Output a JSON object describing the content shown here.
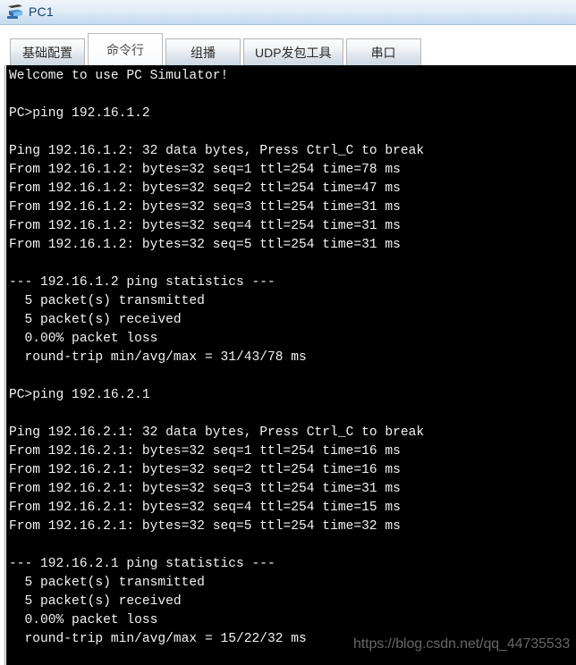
{
  "window": {
    "title": "PC1",
    "icon": "pc-device-icon"
  },
  "tabs": [
    {
      "label": "基础配置",
      "active": false
    },
    {
      "label": "命令行",
      "active": true
    },
    {
      "label": "组播",
      "active": false
    },
    {
      "label": "UDP发包工具",
      "active": false
    },
    {
      "label": "串口",
      "active": false
    }
  ],
  "terminal": {
    "lines": [
      "Welcome to use PC Simulator!",
      "",
      "PC>ping 192.16.1.2",
      "",
      "Ping 192.16.1.2: 32 data bytes, Press Ctrl_C to break",
      "From 192.16.1.2: bytes=32 seq=1 ttl=254 time=78 ms",
      "From 192.16.1.2: bytes=32 seq=2 ttl=254 time=47 ms",
      "From 192.16.1.2: bytes=32 seq=3 ttl=254 time=31 ms",
      "From 192.16.1.2: bytes=32 seq=4 ttl=254 time=31 ms",
      "From 192.16.1.2: bytes=32 seq=5 ttl=254 time=31 ms",
      "",
      "--- 192.16.1.2 ping statistics ---",
      "  5 packet(s) transmitted",
      "  5 packet(s) received",
      "  0.00% packet loss",
      "  round-trip min/avg/max = 31/43/78 ms",
      "",
      "PC>ping 192.16.2.1",
      "",
      "Ping 192.16.2.1: 32 data bytes, Press Ctrl_C to break",
      "From 192.16.2.1: bytes=32 seq=1 ttl=254 time=16 ms",
      "From 192.16.2.1: bytes=32 seq=2 ttl=254 time=16 ms",
      "From 192.16.2.1: bytes=32 seq=3 ttl=254 time=31 ms",
      "From 192.16.2.1: bytes=32 seq=4 ttl=254 time=15 ms",
      "From 192.16.2.1: bytes=32 seq=5 ttl=254 time=32 ms",
      "",
      "--- 192.16.2.1 ping statistics ---",
      "  5 packet(s) transmitted",
      "  5 packet(s) received",
      "  0.00% packet loss",
      "  round-trip min/avg/max = 15/22/32 ms"
    ]
  },
  "watermark": {
    "text": "https://blog.csdn.net/qq_44735533"
  },
  "colors": {
    "titlebar_start": "#eff5fb",
    "titlebar_end": "#c6dcef",
    "title_text": "#15406b",
    "terminal_bg": "#000000",
    "terminal_fg": "#f2f2f2",
    "tab_border": "#b5b5b5"
  }
}
